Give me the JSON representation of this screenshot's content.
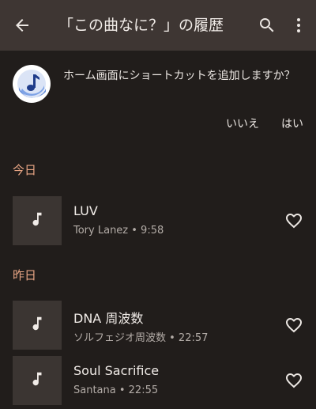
{
  "toolbar": {
    "title": "「この曲なに？」の履歴",
    "back_icon": "arrow-back-icon",
    "search_icon": "search-icon",
    "more_icon": "more-vert-icon"
  },
  "prompt": {
    "icon": "music-note-app-icon",
    "text": "ホーム画面にショートカットを追加しますか？",
    "no_label": "いいえ",
    "yes_label": "はい"
  },
  "sections": [
    {
      "heading": "今日",
      "items": [
        {
          "title": "LUV",
          "subtitle": "Tory Lanez • 9:58"
        }
      ]
    },
    {
      "heading": "昨日",
      "items": [
        {
          "title": "DNA 周波数",
          "subtitle": "ソルフェジオ周波数 • 22:57"
        },
        {
          "title": "Soul Sacrifice",
          "subtitle": "Santana • 22:55"
        }
      ]
    }
  ],
  "colors": {
    "background": "#211d1b",
    "toolbar": "#3e3633",
    "accent": "#e8a584",
    "thumb": "#3b3532"
  }
}
